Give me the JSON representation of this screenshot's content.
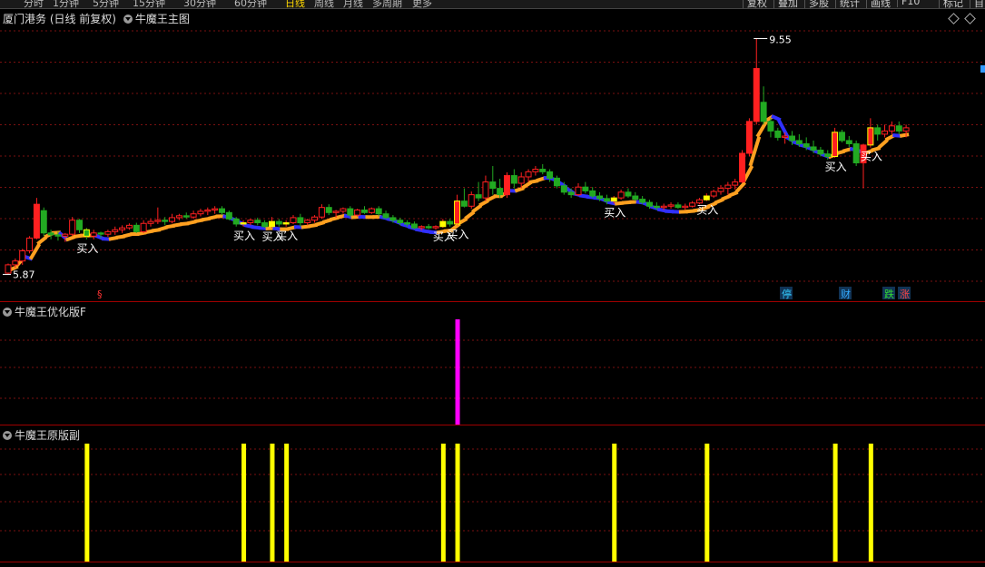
{
  "toolbar": {
    "periods": [
      "分时",
      "1分钟",
      "5分钟",
      "15分钟",
      "30分钟",
      "60分钟",
      "日线",
      "周线",
      "月线",
      "多周期",
      "更多"
    ],
    "selected": "日线",
    "right": [
      "复权",
      "叠加",
      "多股",
      "统计",
      "画线",
      "F10",
      "标记",
      "自"
    ]
  },
  "main": {
    "stock": "厦门港务 (日线 前复权)",
    "indicator": "牛魔王主图",
    "high_label": "9.55",
    "low_label": "5.87",
    "buy_label": "买入",
    "events": [
      {
        "text": "§",
        "color": "#ff3333"
      },
      {
        "text": "停",
        "color": "#33ccff"
      },
      {
        "text": "财",
        "color": "#33aaff"
      },
      {
        "text": "跌",
        "color": "#33dd33"
      },
      {
        "text": "涨",
        "color": "#ff4444"
      }
    ]
  },
  "sub1": {
    "title": "牛魔王优化版F",
    "color": "#ff00ff"
  },
  "sub2": {
    "title": "牛魔王原版副",
    "color": "#ffff00"
  },
  "colors": {
    "up": "#ff2020",
    "down": "#22aa22",
    "line_up": "#ffa020",
    "line_down": "#3030ff",
    "signal": "#ffff00"
  },
  "chart_data": {
    "type": "candlestick",
    "ohlc": [
      [
        5.87,
        6.02,
        5.85,
        6.0
      ],
      [
        6.0,
        6.1,
        5.95,
        6.06
      ],
      [
        6.06,
        6.25,
        6.0,
        6.22
      ],
      [
        6.22,
        6.45,
        6.18,
        6.42
      ],
      [
        6.42,
        7.05,
        6.4,
        6.95
      ],
      [
        6.85,
        6.9,
        6.45,
        6.5
      ],
      [
        6.5,
        6.55,
        6.4,
        6.47
      ],
      [
        6.47,
        6.52,
        6.38,
        6.45
      ],
      [
        6.45,
        6.5,
        6.36,
        6.48
      ],
      [
        6.48,
        6.75,
        6.45,
        6.7
      ],
      [
        6.7,
        6.72,
        6.5,
        6.55
      ],
      [
        6.55,
        6.58,
        6.4,
        6.45
      ],
      [
        6.45,
        6.55,
        6.4,
        6.5
      ],
      [
        6.5,
        6.52,
        6.42,
        6.48
      ],
      [
        6.48,
        6.55,
        6.44,
        6.52
      ],
      [
        6.52,
        6.6,
        6.47,
        6.55
      ],
      [
        6.55,
        6.62,
        6.5,
        6.58
      ],
      [
        6.58,
        6.65,
        6.55,
        6.62
      ],
      [
        6.62,
        6.66,
        6.5,
        6.52
      ],
      [
        6.52,
        6.7,
        6.5,
        6.65
      ],
      [
        6.65,
        6.72,
        6.6,
        6.68
      ],
      [
        6.68,
        6.9,
        6.64,
        6.7
      ],
      [
        6.7,
        6.75,
        6.62,
        6.68
      ],
      [
        6.68,
        6.8,
        6.65,
        6.74
      ],
      [
        6.74,
        6.8,
        6.7,
        6.77
      ],
      [
        6.77,
        6.82,
        6.72,
        6.75
      ],
      [
        6.75,
        6.85,
        6.72,
        6.8
      ],
      [
        6.8,
        6.88,
        6.76,
        6.84
      ],
      [
        6.84,
        6.9,
        6.78,
        6.86
      ],
      [
        6.86,
        6.92,
        6.8,
        6.88
      ],
      [
        6.88,
        6.92,
        6.78,
        6.82
      ],
      [
        6.82,
        6.85,
        6.7,
        6.72
      ],
      [
        6.72,
        6.75,
        6.6,
        6.64
      ],
      [
        6.64,
        6.7,
        6.6,
        6.66
      ],
      [
        6.66,
        6.72,
        6.62,
        6.7
      ],
      [
        6.7,
        6.74,
        6.62,
        6.66
      ],
      [
        6.66,
        6.7,
        6.58,
        6.6
      ],
      [
        6.6,
        6.75,
        6.58,
        6.68
      ],
      [
        6.68,
        6.72,
        6.6,
        6.64
      ],
      [
        6.64,
        6.7,
        6.6,
        6.66
      ],
      [
        6.66,
        6.78,
        6.64,
        6.74
      ],
      [
        6.74,
        6.8,
        6.6,
        6.66
      ],
      [
        6.66,
        6.72,
        6.62,
        6.7
      ],
      [
        6.7,
        6.78,
        6.66,
        6.75
      ],
      [
        6.75,
        6.95,
        6.72,
        6.9
      ],
      [
        6.9,
        6.95,
        6.78,
        6.82
      ],
      [
        6.82,
        6.86,
        6.74,
        6.84
      ],
      [
        6.84,
        6.9,
        6.8,
        6.88
      ],
      [
        6.88,
        6.92,
        6.74,
        6.78
      ],
      [
        6.78,
        6.88,
        6.76,
        6.86
      ],
      [
        6.86,
        6.92,
        6.8,
        6.82
      ],
      [
        6.82,
        6.9,
        6.8,
        6.88
      ],
      [
        6.88,
        6.92,
        6.76,
        6.8
      ],
      [
        6.8,
        6.85,
        6.72,
        6.74
      ],
      [
        6.74,
        6.78,
        6.66,
        6.7
      ],
      [
        6.7,
        6.74,
        6.62,
        6.66
      ],
      [
        6.66,
        6.7,
        6.6,
        6.64
      ],
      [
        6.64,
        6.68,
        6.56,
        6.58
      ],
      [
        6.58,
        6.62,
        6.54,
        6.6
      ],
      [
        6.6,
        6.64,
        6.56,
        6.58
      ],
      [
        6.58,
        6.62,
        6.55,
        6.6
      ],
      [
        6.6,
        6.72,
        6.58,
        6.68
      ],
      [
        6.68,
        6.72,
        6.6,
        6.64
      ],
      [
        6.64,
        7.1,
        6.62,
        7.0
      ],
      [
        7.0,
        7.2,
        6.9,
        6.92
      ],
      [
        6.92,
        7.15,
        6.88,
        7.1
      ],
      [
        7.1,
        7.3,
        7.0,
        7.05
      ],
      [
        7.05,
        7.4,
        7.0,
        7.3
      ],
      [
        7.3,
        7.55,
        7.1,
        7.2
      ],
      [
        7.2,
        7.35,
        7.05,
        7.1
      ],
      [
        7.1,
        7.45,
        7.05,
        7.4
      ],
      [
        7.4,
        7.5,
        7.2,
        7.28
      ],
      [
        7.28,
        7.45,
        7.2,
        7.38
      ],
      [
        7.38,
        7.5,
        7.3,
        7.46
      ],
      [
        7.46,
        7.55,
        7.4,
        7.5
      ],
      [
        7.5,
        7.58,
        7.42,
        7.46
      ],
      [
        7.46,
        7.5,
        7.3,
        7.36
      ],
      [
        7.36,
        7.4,
        7.2,
        7.24
      ],
      [
        7.24,
        7.3,
        7.1,
        7.14
      ],
      [
        7.14,
        7.2,
        7.05,
        7.1
      ],
      [
        7.1,
        7.28,
        7.08,
        7.22
      ],
      [
        7.22,
        7.3,
        7.12,
        7.16
      ],
      [
        7.16,
        7.22,
        7.05,
        7.08
      ],
      [
        7.08,
        7.14,
        7.0,
        7.04
      ],
      [
        7.04,
        7.1,
        6.95,
        7.0
      ],
      [
        7.0,
        7.08,
        6.96,
        7.05
      ],
      [
        7.05,
        7.18,
        7.02,
        7.14
      ],
      [
        7.14,
        7.2,
        7.05,
        7.08
      ],
      [
        7.08,
        7.14,
        7.0,
        7.03
      ],
      [
        7.03,
        7.08,
        6.95,
        6.98
      ],
      [
        6.98,
        7.02,
        6.88,
        6.92
      ],
      [
        6.92,
        6.98,
        6.86,
        6.9
      ],
      [
        6.9,
        6.96,
        6.86,
        6.92
      ],
      [
        6.92,
        6.98,
        6.88,
        6.94
      ],
      [
        6.94,
        6.98,
        6.88,
        6.9
      ],
      [
        6.9,
        6.96,
        6.86,
        6.92
      ],
      [
        6.92,
        7.0,
        6.9,
        6.97
      ],
      [
        6.97,
        7.05,
        6.95,
        7.02
      ],
      [
        7.02,
        7.12,
        7.0,
        7.08
      ],
      [
        7.08,
        7.18,
        7.05,
        7.15
      ],
      [
        7.15,
        7.25,
        7.1,
        7.2
      ],
      [
        7.2,
        7.3,
        7.1,
        7.25
      ],
      [
        7.25,
        7.35,
        7.18,
        7.3
      ],
      [
        7.3,
        7.8,
        7.28,
        7.75
      ],
      [
        7.75,
        8.3,
        7.7,
        8.25
      ],
      [
        8.25,
        9.55,
        8.2,
        9.08
      ],
      [
        8.55,
        8.8,
        8.2,
        8.25
      ],
      [
        8.25,
        8.3,
        8.0,
        8.1
      ],
      [
        8.1,
        8.15,
        7.95,
        8.0
      ],
      [
        8.0,
        8.08,
        7.9,
        8.02
      ],
      [
        8.02,
        8.1,
        7.88,
        7.95
      ],
      [
        7.95,
        8.05,
        7.85,
        7.9
      ],
      [
        7.9,
        8.0,
        7.8,
        7.85
      ],
      [
        7.85,
        7.95,
        7.75,
        7.8
      ],
      [
        7.8,
        7.85,
        7.7,
        7.74
      ],
      [
        7.74,
        7.8,
        7.65,
        7.7
      ],
      [
        7.7,
        8.15,
        7.68,
        8.08
      ],
      [
        8.08,
        8.12,
        7.92,
        7.95
      ],
      [
        7.95,
        8.02,
        7.85,
        7.9
      ],
      [
        7.9,
        7.95,
        7.55,
        7.6
      ],
      [
        7.6,
        7.9,
        7.2,
        7.88
      ],
      [
        7.88,
        8.3,
        7.84,
        8.15
      ],
      [
        8.15,
        8.2,
        7.95,
        8.05
      ],
      [
        8.05,
        8.2,
        8.0,
        8.1
      ],
      [
        8.1,
        8.25,
        8.05,
        8.18
      ],
      [
        8.18,
        8.25,
        8.05,
        8.1
      ],
      [
        8.1,
        8.2,
        8.0,
        8.15
      ]
    ],
    "sub1_signal_bars": [
      63
    ],
    "sub2_signal_bars": [
      11,
      33,
      37,
      39,
      61,
      63,
      85,
      98,
      116,
      121
    ],
    "buy_signal_bars": [
      11,
      33,
      37,
      39,
      61,
      63,
      85,
      98,
      116,
      121
    ]
  }
}
